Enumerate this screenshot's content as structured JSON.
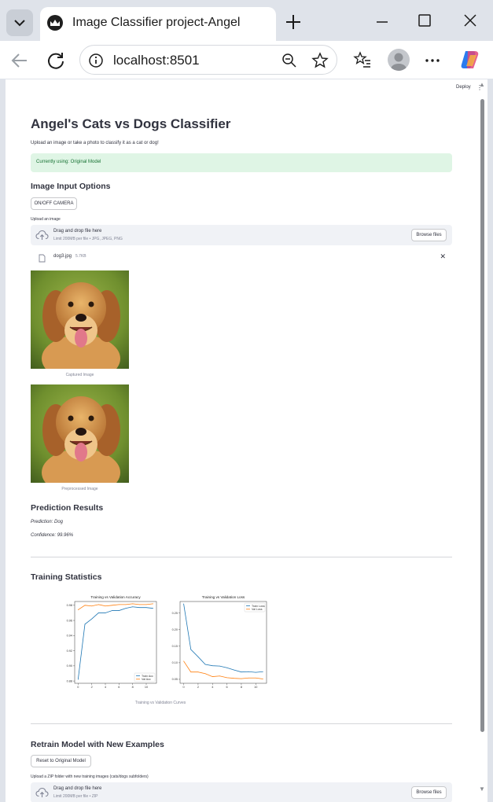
{
  "browser": {
    "tab_title": "Image Classifier project-Angel",
    "url": "localhost:8501",
    "icons": [
      "tab-list-icon",
      "streamlit-favicon",
      "close-icon",
      "plus-icon",
      "minimize-icon",
      "maximize-icon",
      "close-window-icon",
      "back-icon",
      "reload-icon",
      "info-icon",
      "zoom-out-icon",
      "star-icon",
      "favorites-icon",
      "profile-icon",
      "more-icon",
      "copilot-icon"
    ]
  },
  "app": {
    "deploy_label": "Deploy",
    "menu_label": "⋮",
    "title": "Angel's Cats vs Dogs Classifier",
    "subtitle": "Upload an image or take a photo to classify it as a cat or dog!",
    "model_status": "Currently using: Original Model",
    "image_input": {
      "heading": "Image Input Options",
      "camera_button": "ON/OFF CAMERA",
      "upload_label": "Upload an image",
      "dropzone_title": "Drag and drop file here",
      "dropzone_limit": "Limit 200MB per file • JPG, JPEG, PNG",
      "browse_button": "Browse files",
      "file_name": "dog3.jpg",
      "file_size": "5.7KB",
      "remove_label": "✕"
    },
    "captured_caption": "Captured Image",
    "preprocessed_caption": "Preprocessed Image",
    "prediction": {
      "heading": "Prediction Results",
      "prediction_text": "Prediction: Dog",
      "confidence_text": "Confidence: 99.96%"
    },
    "training": {
      "heading": "Training Statistics",
      "caption": "Training vs Validation Curves"
    },
    "retrain": {
      "heading": "Retrain Model with New Examples",
      "reset_button": "Reset to Original Model",
      "upload_label": "Upload a ZIP folder with new training images (cats/dogs subfolders)",
      "dropzone_title": "Drag and drop file here",
      "dropzone_limit": "Limit 200MB per file • ZIP",
      "browse_button": "Browse files"
    },
    "colors": {
      "train": "#1f77b4",
      "val": "#ff7f0e",
      "success_bg": "#dff5e5",
      "success_text": "#177233"
    }
  },
  "chart_data": [
    {
      "type": "line",
      "title": "Training vs Validation Accuracy",
      "x": [
        0,
        1,
        2,
        3,
        4,
        5,
        6,
        7,
        8,
        9,
        10,
        11
      ],
      "xticks": [
        0,
        2,
        4,
        6,
        8,
        10
      ],
      "yticks": [
        "0.88",
        "0.90",
        "0.92",
        "0.94",
        "0.96",
        "0.98"
      ],
      "ylim": [
        0.877,
        0.985
      ],
      "xlim": [
        -0.5,
        11.5
      ],
      "series": [
        {
          "name": "Train Acc",
          "values": [
            0.882,
            0.955,
            0.962,
            0.97,
            0.97,
            0.973,
            0.973,
            0.976,
            0.978,
            0.977,
            0.977,
            0.976
          ]
        },
        {
          "name": "Val Acc",
          "values": [
            0.974,
            0.98,
            0.979,
            0.981,
            0.979,
            0.98,
            0.981,
            0.981,
            0.982,
            0.981,
            0.981,
            0.982
          ]
        }
      ],
      "legend": "bottom-right"
    },
    {
      "type": "line",
      "title": "Training vs Validation Loss",
      "x": [
        0,
        1,
        2,
        3,
        4,
        5,
        6,
        7,
        8,
        9,
        10,
        11
      ],
      "xticks": [
        0,
        2,
        4,
        6,
        8,
        10
      ],
      "yticks": [
        "0.05",
        "0.10",
        "0.15",
        "0.20",
        "0.25"
      ],
      "ylim": [
        0.038,
        0.285
      ],
      "xlim": [
        -0.5,
        11.5
      ],
      "series": [
        {
          "name": "Train Loss",
          "values": [
            0.278,
            0.14,
            0.118,
            0.095,
            0.091,
            0.09,
            0.085,
            0.078,
            0.072,
            0.073,
            0.071,
            0.073
          ]
        },
        {
          "name": "Val Loss",
          "values": [
            0.105,
            0.072,
            0.072,
            0.067,
            0.058,
            0.06,
            0.055,
            0.053,
            0.052,
            0.054,
            0.054,
            0.051
          ]
        }
      ],
      "legend": "top-right"
    }
  ]
}
